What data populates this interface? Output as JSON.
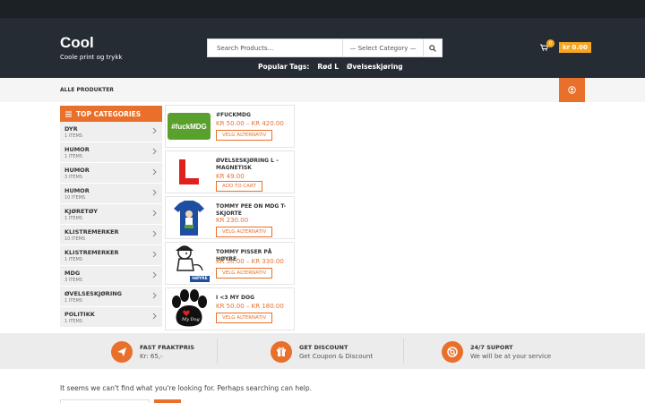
{
  "brand": {
    "title": "Cool",
    "tagline": "Coole print og trykk"
  },
  "search": {
    "placeholder": "Search Products...",
    "category": "— Select Category —"
  },
  "popular_tags": {
    "label": "Popular Tags:",
    "tags": [
      "Rød L",
      "Øvelseskjøring"
    ]
  },
  "cart": {
    "count": "0",
    "amount": "kr 0.00"
  },
  "nav": {
    "all_products": "ALLE PRODUKTER"
  },
  "sidebar": {
    "heading": "TOP CATEGORIES",
    "items": [
      {
        "name": "DYR",
        "count": "1 ITEMS"
      },
      {
        "name": "HUMOR",
        "count": "1 ITEMS"
      },
      {
        "name": "HUMOR",
        "count": "3 ITEMS"
      },
      {
        "name": "HUMOR",
        "count": "10 ITEMS"
      },
      {
        "name": "KJØRETØY",
        "count": "1 ITEMS"
      },
      {
        "name": "KLISTREMERKER",
        "count": "10 ITEMS"
      },
      {
        "name": "KLISTREMERKER",
        "count": "1 ITEMS"
      },
      {
        "name": "MDG",
        "count": "3 ITEMS"
      },
      {
        "name": "ØVELSESKJØRING",
        "count": "1 ITEMS"
      },
      {
        "name": "POLITIKK",
        "count": "1 ITEMS"
      }
    ]
  },
  "products": [
    {
      "name": "#FUCKMDG",
      "price": "KR 50.00 – KR 420.00",
      "button": "VELG ALTERNATIV",
      "image_text": "#fuckMDG"
    },
    {
      "name": "ØVELSESKJØRING L – MAGNETISK",
      "price": "KR 49.00",
      "button": "ADD TO CART",
      "image_text": ""
    },
    {
      "name": "TOMMY PEE ON MDG T-SKJORTE",
      "price": "KR 230.00",
      "button": "VELG ALTERNATIV",
      "image_text": ""
    },
    {
      "name": "TOMMY PISSER PÅ HØYRE",
      "price": "KR 50.00 – KR 330.00",
      "button": "VELG ALTERNATIV",
      "image_text": "HØYRE"
    },
    {
      "name": "I <3 MY DOG",
      "price": "KR 50.00 – KR 180.00",
      "button": "VELG ALTERNATIV",
      "image_text": "My Dog"
    }
  ],
  "features": [
    {
      "title": "FAST FRAKTPRIS",
      "subtitle": "Kr: 65,-",
      "icon": "paper-plane-icon"
    },
    {
      "title": "GET DISCOUNT",
      "subtitle": "Get Coupon & Discount",
      "icon": "gift-icon"
    },
    {
      "title": "24/7 SUPORT",
      "subtitle": "We will be at your service",
      "icon": "life-ring-icon"
    }
  ],
  "not_found": "It seems we can't find what you're looking for. Perhaps searching can help.",
  "colors": {
    "accent": "#e8702a",
    "header": "#262c33",
    "cart": "#f5a623"
  }
}
